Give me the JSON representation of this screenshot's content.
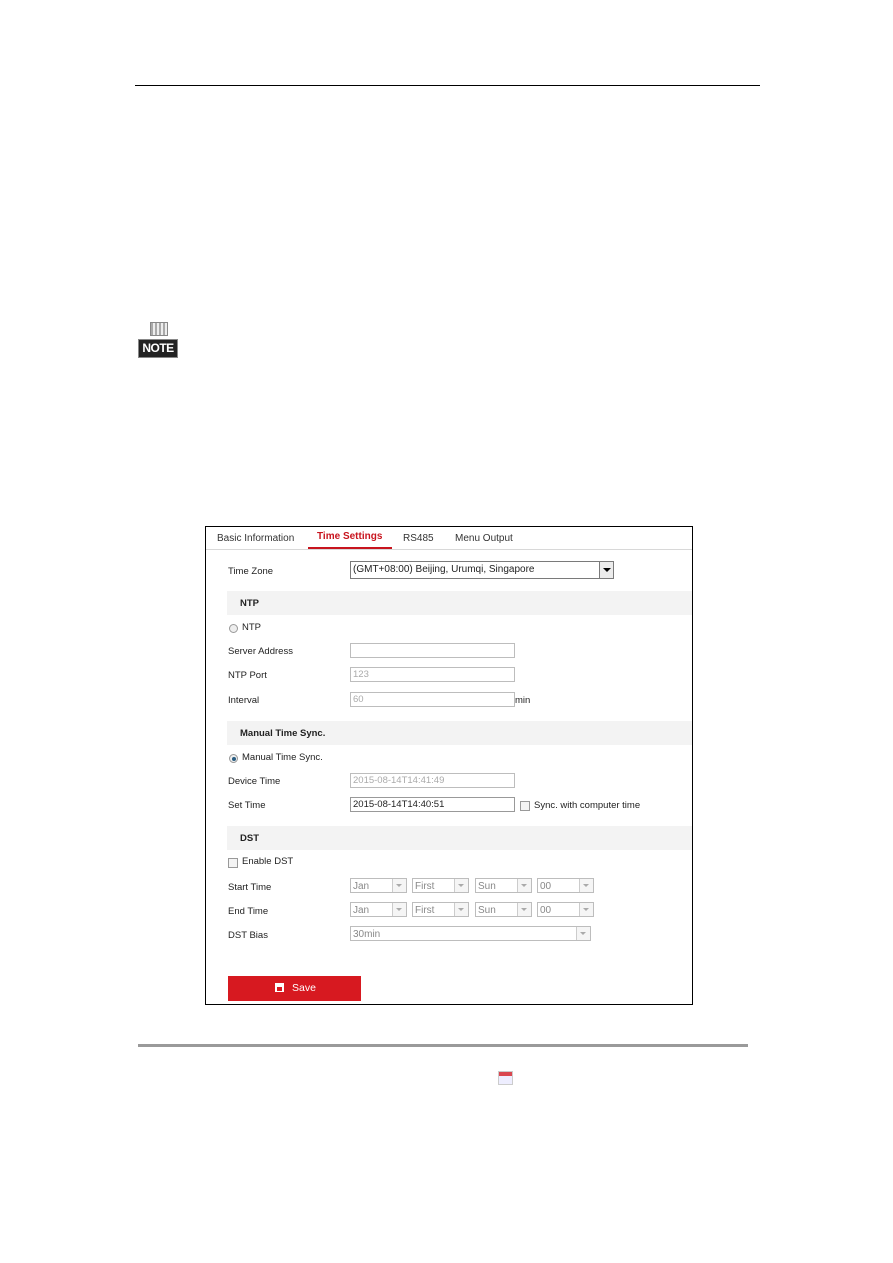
{
  "document": {
    "note_label": "NOTE"
  },
  "ui": {
    "tabs": [
      {
        "label": "Basic Information",
        "active": false
      },
      {
        "label": "Time Settings",
        "active": true
      },
      {
        "label": "RS485",
        "active": false
      },
      {
        "label": "Menu Output",
        "active": false
      }
    ],
    "time_zone": {
      "label": "Time Zone",
      "value": "(GMT+08:00) Beijing, Urumqi, Singapore"
    },
    "ntp": {
      "section_title": "NTP",
      "radio_label": "NTP",
      "radio_selected": false,
      "server_address": {
        "label": "Server Address",
        "value": ""
      },
      "ntp_port": {
        "label": "NTP Port",
        "value": "123"
      },
      "interval": {
        "label": "Interval",
        "value": "60",
        "unit": "min"
      }
    },
    "manual": {
      "section_title": "Manual Time Sync.",
      "radio_label": "Manual Time Sync.",
      "radio_selected": true,
      "device_time": {
        "label": "Device Time",
        "value": "2015-08-14T14:41:49"
      },
      "set_time": {
        "label": "Set Time",
        "value": "2015-08-14T14:40:51"
      },
      "sync_label": "Sync. with computer time",
      "sync_checked": false
    },
    "dst": {
      "section_title": "DST",
      "enable_label": "Enable DST",
      "enable_checked": false,
      "start_time": {
        "label": "Start Time",
        "month": "Jan",
        "week": "First",
        "day": "Sun",
        "hour": "00"
      },
      "end_time": {
        "label": "End Time",
        "month": "Jan",
        "week": "First",
        "day": "Sun",
        "hour": "00"
      },
      "bias": {
        "label": "DST Bias",
        "value": "30min"
      }
    },
    "save_label": "Save",
    "colors": {
      "accent": "#c8141e",
      "save_button": "#d71920"
    }
  }
}
